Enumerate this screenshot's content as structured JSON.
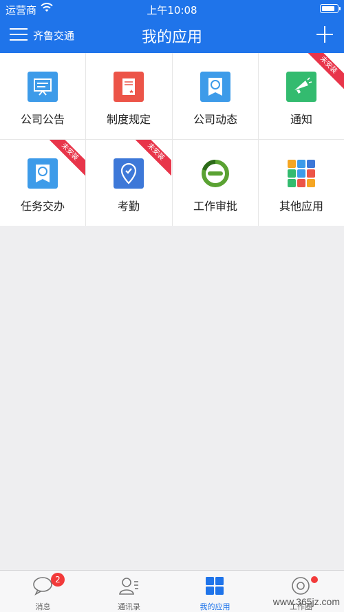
{
  "status_bar": {
    "carrier": "运营商",
    "time": "上午10:08"
  },
  "nav": {
    "menu_label": "齐鲁交通",
    "title": "我的应用"
  },
  "apps": [
    {
      "label": "公司公告",
      "icon": "announcement-icon",
      "installed": true
    },
    {
      "label": "制度规定",
      "icon": "regulation-book-icon",
      "installed": true
    },
    {
      "label": "公司动态",
      "icon": "badge-icon",
      "installed": true
    },
    {
      "label": "通知",
      "icon": "megaphone-icon",
      "installed": false,
      "ribbon": "未安装"
    },
    {
      "label": "任务交办",
      "icon": "badge-icon",
      "installed": false,
      "ribbon": "未安装"
    },
    {
      "label": "考勤",
      "icon": "location-check-icon",
      "installed": false,
      "ribbon": "未安装"
    },
    {
      "label": "工作审批",
      "icon": "approval-cycle-icon",
      "installed": true
    },
    {
      "label": "其他应用",
      "icon": "app-grid-icon",
      "installed": true
    }
  ],
  "tabs": [
    {
      "label": "消息",
      "icon": "chat-bubble-icon",
      "badge": "2"
    },
    {
      "label": "通讯录",
      "icon": "contacts-icon"
    },
    {
      "label": "我的应用",
      "icon": "apps-grid-icon",
      "active": true
    },
    {
      "label": "工作圈",
      "icon": "work-circle-icon",
      "dot": true
    }
  ],
  "colors": {
    "brand": "#1f74ea",
    "ribbon": "#e8354a",
    "badge": "#f23a3a"
  },
  "watermark": "www.365jz.com"
}
